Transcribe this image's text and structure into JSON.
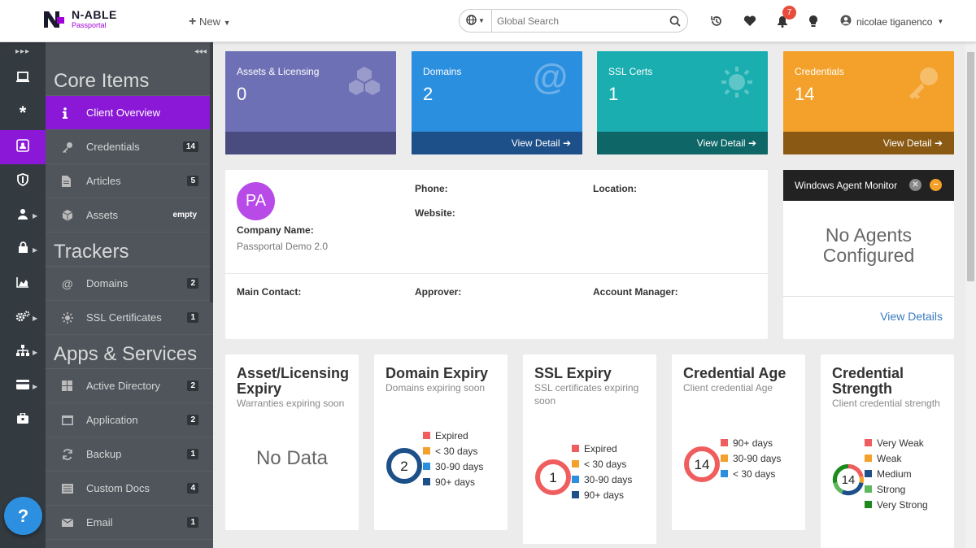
{
  "brand": {
    "name": "N-ABLE",
    "product": "Passportal"
  },
  "topbar": {
    "new_label": "New",
    "search_placeholder": "Global Search",
    "notification_count": "7",
    "user_name": "nicolae tiganenco"
  },
  "sidebar": {
    "sections": [
      {
        "heading": "Core Items",
        "items": [
          {
            "label": "Client Overview",
            "count": ""
          },
          {
            "label": "Credentials",
            "count": "14"
          },
          {
            "label": "Articles",
            "count": "5"
          },
          {
            "label": "Assets",
            "count": "empty"
          }
        ]
      },
      {
        "heading": "Trackers",
        "items": [
          {
            "label": "Domains",
            "count": "2"
          },
          {
            "label": "SSL Certificates",
            "count": "1"
          }
        ]
      },
      {
        "heading": "Apps & Services",
        "items": [
          {
            "label": "Active Directory",
            "count": "2"
          },
          {
            "label": "Application",
            "count": "2"
          },
          {
            "label": "Backup",
            "count": "1"
          },
          {
            "label": "Custom Docs",
            "count": "4"
          },
          {
            "label": "Email",
            "count": "1"
          }
        ]
      }
    ]
  },
  "tiles": [
    {
      "label": "Assets & Licensing",
      "value": "0",
      "footer": "",
      "color": "#6e70b5",
      "foot_color": "#4a4b7f"
    },
    {
      "label": "Domains",
      "value": "2",
      "footer": "View Detail",
      "color": "#2b8fe0",
      "foot_color": "#1d4f88"
    },
    {
      "label": "SSL Certs",
      "value": "1",
      "footer": "View Detail",
      "color": "#1aaeb0",
      "foot_color": "#0e6666"
    },
    {
      "label": "Credentials",
      "value": "14",
      "footer": "View Detail",
      "color": "#f3a12a",
      "foot_color": "#8a5a14"
    }
  ],
  "client": {
    "avatar": "PA",
    "company_label": "Company Name:",
    "company_value": "Passportal Demo 2.0",
    "phone_label": "Phone:",
    "website_label": "Website:",
    "location_label": "Location:",
    "main_contact_label": "Main Contact:",
    "approver_label": "Approver:",
    "account_manager_label": "Account Manager:"
  },
  "agent_monitor": {
    "title": "Windows Agent Monitor",
    "message_line1": "No Agents",
    "message_line2": "Configured",
    "link": "View Details"
  },
  "charts": [
    {
      "title": "Asset/Licensing Expiry",
      "subtitle": "Warranties expiring soon",
      "center": "",
      "empty_text": "No Data"
    },
    {
      "title": "Domain Expiry",
      "subtitle": "Domains expiring soon",
      "center": "2"
    },
    {
      "title": "SSL Expiry",
      "subtitle": "SSL certificates expiring soon",
      "center": "1"
    },
    {
      "title": "Credential Age",
      "subtitle": "Client credential Age",
      "center": "14"
    },
    {
      "title": "Credential Strength",
      "subtitle": "Client credential strength",
      "center": "14"
    }
  ],
  "chart_data": [
    {
      "type": "pie",
      "title": "Domain Expiry",
      "categories": [
        "Expired",
        "< 30 days",
        "30-90 days",
        "90+ days"
      ],
      "values": [
        0,
        0,
        0,
        2
      ],
      "colors": [
        "#f05d5e",
        "#f3a12a",
        "#2b8fe0",
        "#1d4f88"
      ]
    },
    {
      "type": "pie",
      "title": "SSL Expiry",
      "categories": [
        "Expired",
        "< 30 days",
        "30-90 days",
        "90+ days"
      ],
      "values": [
        1,
        0,
        0,
        0
      ],
      "colors": [
        "#f05d5e",
        "#f3a12a",
        "#2b8fe0",
        "#1d4f88"
      ]
    },
    {
      "type": "pie",
      "title": "Credential Age",
      "categories": [
        "90+ days",
        "30-90 days",
        "< 30 days"
      ],
      "values": [
        14,
        0,
        0
      ],
      "colors": [
        "#f05d5e",
        "#f3a12a",
        "#2b8fe0"
      ]
    },
    {
      "type": "pie",
      "title": "Credential Strength",
      "categories": [
        "Very Weak",
        "Weak",
        "Medium",
        "Strong",
        "Very Strong"
      ],
      "values": [
        3,
        1,
        4,
        2,
        4
      ],
      "colors": [
        "#f05d5e",
        "#f3a12a",
        "#1d4f88",
        "#5fb85c",
        "#1e8a1e"
      ]
    }
  ]
}
